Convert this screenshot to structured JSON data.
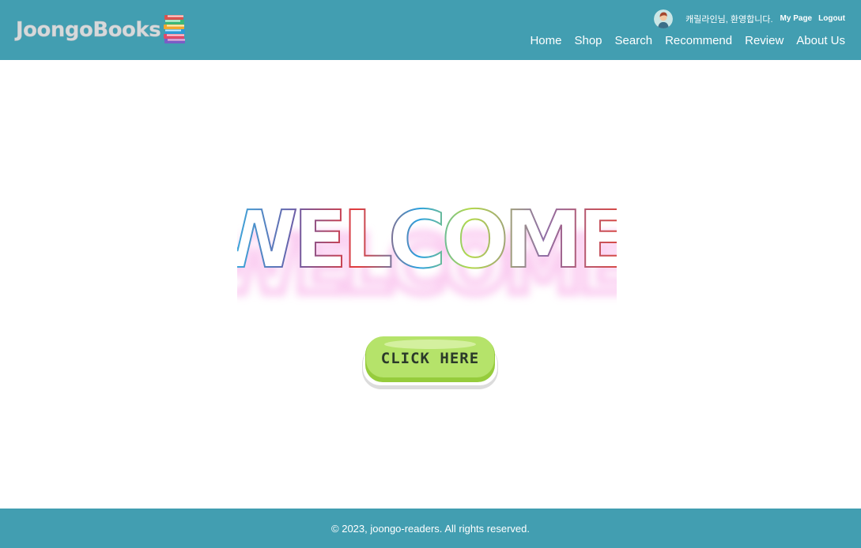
{
  "header": {
    "logo_text": "JoongoBooks",
    "user": {
      "avatar_icon": "user-avatar-icon",
      "greeting": "캐릴라인님, 환영합니다.",
      "links": [
        "My Page",
        "Logout"
      ]
    },
    "nav": [
      "Home",
      "Shop",
      "Search",
      "Recommend",
      "Review",
      "About Us"
    ]
  },
  "main": {
    "hero_text": "WELCOME",
    "cta_label": "CLICK HERE"
  },
  "footer": {
    "copyright": "© 2023, joongo-readers. All rights reserved."
  },
  "colors": {
    "header_bg": "#429eb1",
    "button_green": "#b5e36a"
  }
}
